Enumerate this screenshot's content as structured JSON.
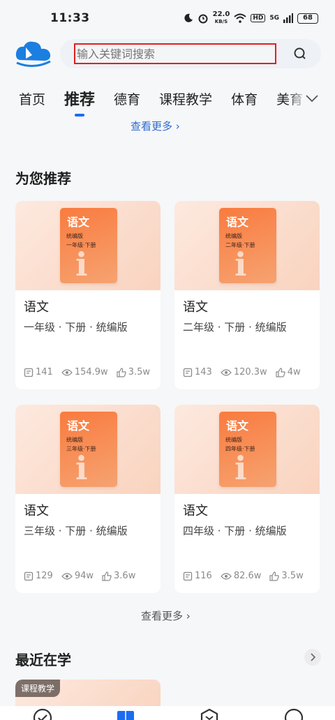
{
  "status": {
    "time": "11:33",
    "speed_value": "22.0",
    "speed_unit": "KB/S",
    "hd": "HD",
    "network": "5G",
    "battery": "68"
  },
  "search": {
    "placeholder": "输入关键词搜索"
  },
  "tabs": [
    {
      "label": "首页"
    },
    {
      "label": "推荐"
    },
    {
      "label": "德育"
    },
    {
      "label": "课程教学"
    },
    {
      "label": "体育"
    },
    {
      "label": "美育"
    }
  ],
  "see_more_top": "查看更多 ›",
  "recommend": {
    "title": "为您推荐",
    "cards": [
      {
        "cover_title": "语文",
        "cover_edition": "统编版",
        "cover_grade": "一年级·下册",
        "cover_char": "i",
        "title": "语文",
        "subtitle": "一年级 · 下册 · 统编版",
        "lessons": "141",
        "views": "154.9w",
        "likes": "3.5w"
      },
      {
        "cover_title": "语文",
        "cover_edition": "统编版",
        "cover_grade": "二年级·下册",
        "cover_char": "i",
        "title": "语文",
        "subtitle": "二年级 · 下册 · 统编版",
        "lessons": "143",
        "views": "120.3w",
        "likes": "4w"
      },
      {
        "cover_title": "语文",
        "cover_edition": "统编版",
        "cover_grade": "三年级·下册",
        "cover_char": "i",
        "title": "语文",
        "subtitle": "三年级 · 下册 · 统编版",
        "lessons": "129",
        "views": "94w",
        "likes": "3.6w"
      },
      {
        "cover_title": "语文",
        "cover_edition": "统编版",
        "cover_grade": "四年级·下册",
        "cover_char": "i",
        "title": "语文",
        "subtitle": "四年级 · 下册 · 统编版",
        "lessons": "116",
        "views": "82.6w",
        "likes": "3.5w"
      }
    ],
    "see_more": "查看更多 ›"
  },
  "recent": {
    "title": "最近在学",
    "tag": "课程教学"
  },
  "colors": {
    "accent": "#1b6cf2",
    "link": "#2d6bd0",
    "highlight_border": "#e02020",
    "cover_orange": "#f97b3f"
  }
}
